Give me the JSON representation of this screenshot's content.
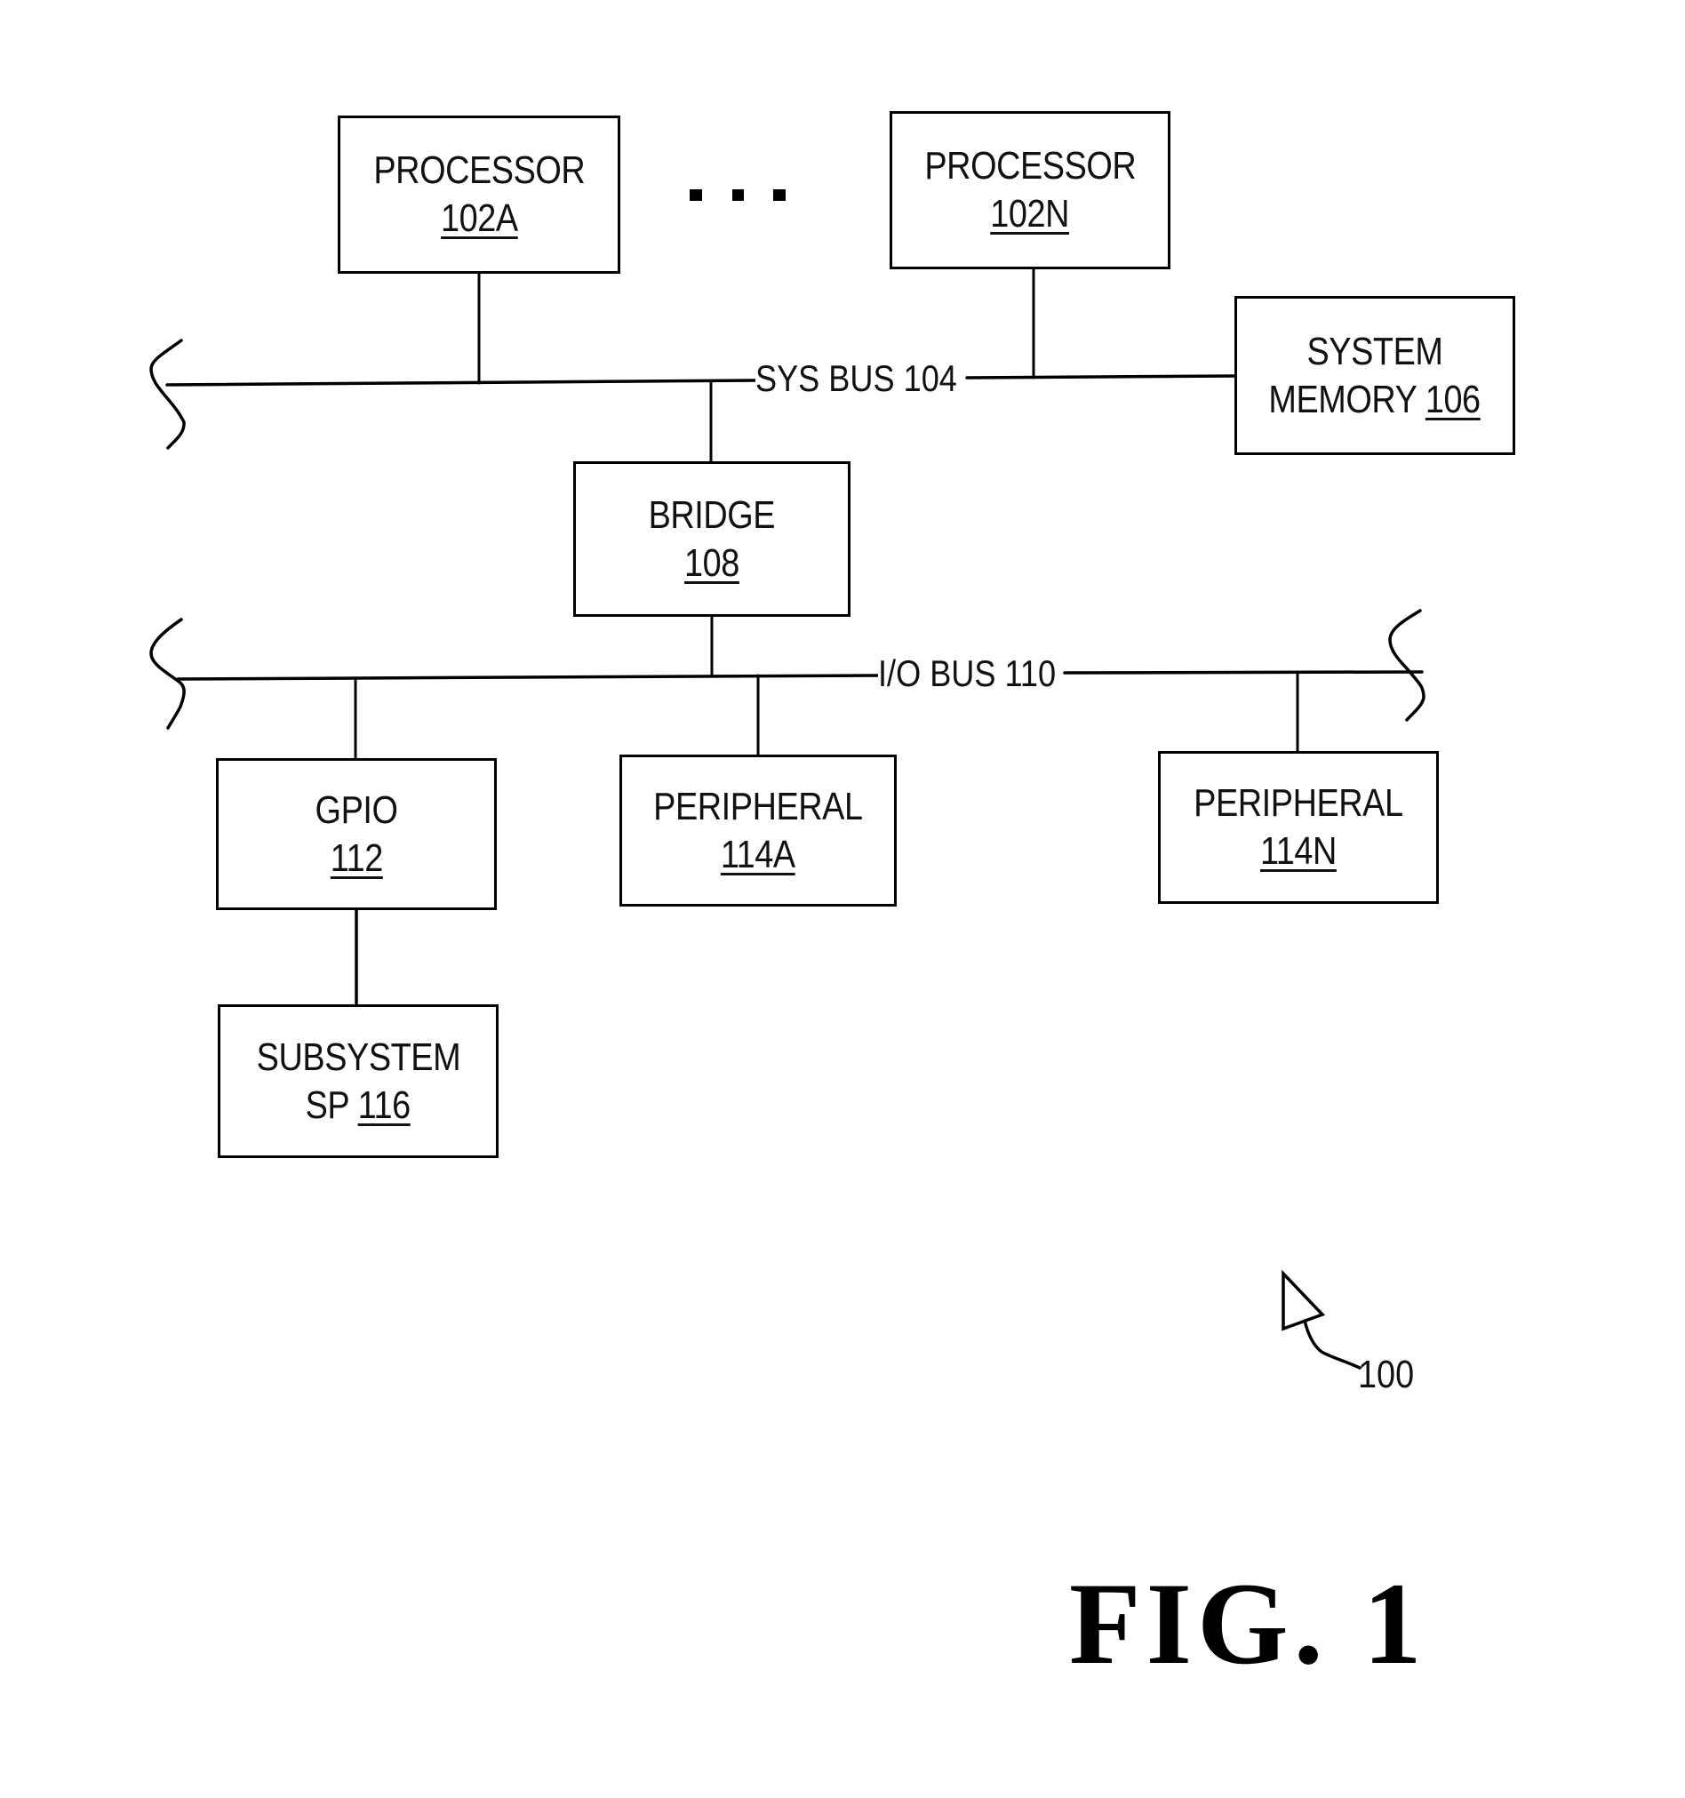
{
  "figure": {
    "caption": "FIG. 1",
    "reference_numeral": "100"
  },
  "buses": {
    "sys_bus": {
      "label": "SYS BUS 104"
    },
    "io_bus": {
      "label": "I/O BUS 110"
    }
  },
  "ellipsis": "...",
  "blocks": {
    "processor_a": {
      "name": "PROCESSOR",
      "ref": "102A"
    },
    "processor_n": {
      "name": "PROCESSOR",
      "ref": "102N"
    },
    "system_memory": {
      "name_line1": "SYSTEM",
      "name_line2": "MEMORY",
      "ref": "106"
    },
    "bridge": {
      "name": "BRIDGE",
      "ref": "108"
    },
    "gpio": {
      "name": "GPIO",
      "ref": "112"
    },
    "peripheral_a": {
      "name": "PERIPHERAL",
      "ref": "114A"
    },
    "peripheral_n": {
      "name": "PERIPHERAL",
      "ref": "114N"
    },
    "subsystem": {
      "name_line1": "SUBSYSTEM",
      "name_prefix": "SP",
      "ref": "116"
    }
  }
}
